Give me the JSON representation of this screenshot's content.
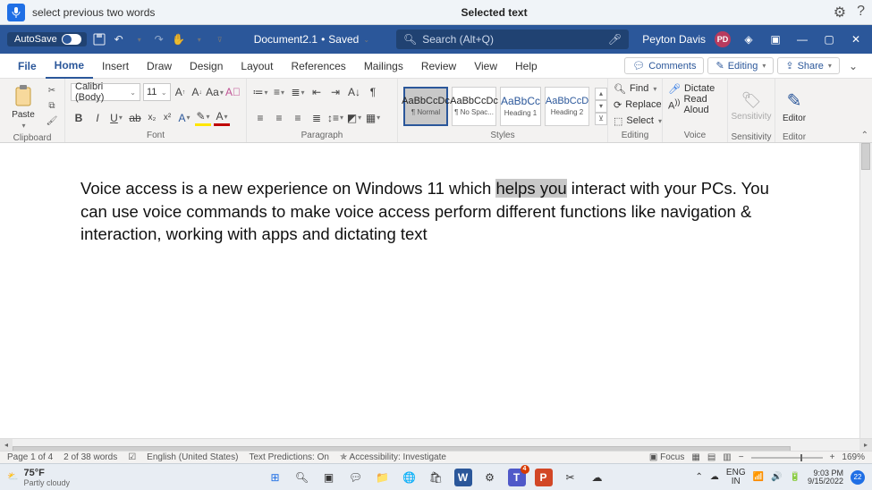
{
  "voice_bar": {
    "command": "select previous two words",
    "center": "Selected text"
  },
  "title_bar": {
    "autosave_label": "AutoSave",
    "autosave_on": "On",
    "doc_name": "Document2.1",
    "saved_state": "Saved",
    "search_placeholder": "Search (Alt+Q)",
    "user_name": "Peyton Davis",
    "user_initials": "PD"
  },
  "tabs": {
    "file": "File",
    "home": "Home",
    "insert": "Insert",
    "draw": "Draw",
    "design": "Design",
    "layout": "Layout",
    "references": "References",
    "mailings": "Mailings",
    "review": "Review",
    "view": "View",
    "help": "Help",
    "comments": "Comments",
    "editing": "Editing",
    "share": "Share"
  },
  "ribbon": {
    "clipboard": {
      "label": "Clipboard",
      "paste": "Paste"
    },
    "font": {
      "label": "Font",
      "name": "Calibri (Body)",
      "size": "11"
    },
    "paragraph": {
      "label": "Paragraph"
    },
    "styles": {
      "label": "Styles",
      "tiles": [
        {
          "sample": "AaBbCcDc",
          "name": "¶ Normal"
        },
        {
          "sample": "AaBbCcDc",
          "name": "¶ No Spac..."
        },
        {
          "sample": "AaBbCc",
          "name": "Heading 1"
        },
        {
          "sample": "AaBbCcD",
          "name": "Heading 2"
        }
      ]
    },
    "editing": {
      "label": "Editing",
      "find": "Find",
      "replace": "Replace",
      "select": "Select"
    },
    "voice": {
      "label": "Voice",
      "dictate": "Dictate",
      "read": "Read Aloud"
    },
    "sensitivity": {
      "label": "Sensitivity",
      "btn": "Sensitivity"
    },
    "editor": {
      "label": "Editor",
      "btn": "Editor"
    }
  },
  "document": {
    "pre": "Voice access is a new experience on Windows 11 which ",
    "selected": "helps you",
    "post": " interact with your PCs. You can use voice commands to make voice access perform different functions like navigation & interaction, working with apps and dictating text"
  },
  "status": {
    "page": "Page 1 of 4",
    "words": "2 of 38 words",
    "lang": "English (United States)",
    "predict": "Text Predictions: On",
    "access": "Accessibility: Investigate",
    "focus": "Focus",
    "zoom": "169%"
  },
  "taskbar": {
    "temp": "75°F",
    "cond": "Partly cloudy",
    "lang1": "ENG",
    "lang2": "IN",
    "time": "9:03 PM",
    "date": "9/15/2022",
    "notif_count": "22"
  }
}
